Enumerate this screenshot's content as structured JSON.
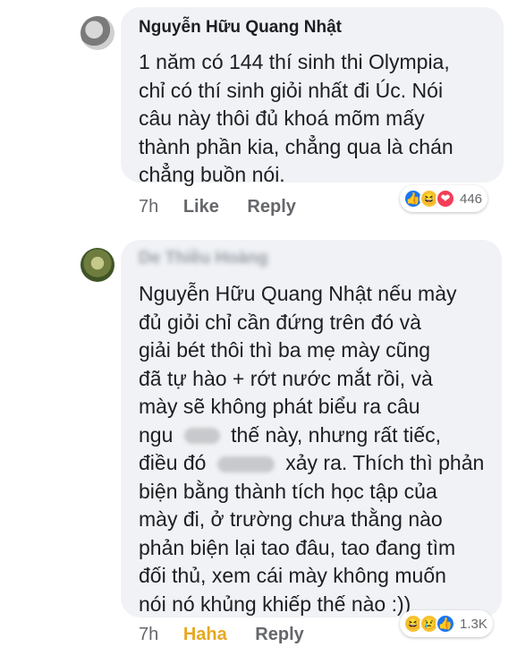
{
  "comments": [
    {
      "author": "Nguyễn Hữu Quang Nhật",
      "lines": [
        "1 năm có 144 thí sinh thi Olympia,",
        "chỉ có thí sinh giỏi nhất đi Úc. Nói",
        "câu này thôi đủ khoá mõm mấy",
        "thành phần kia, chẳng qua là chán",
        "chẳng buồn nói."
      ],
      "time": "7h",
      "action_react": "Like",
      "action_reply": "Reply",
      "reactions": [
        "like",
        "haha",
        "love"
      ],
      "reaction_count": "446"
    },
    {
      "author": "De Thiều Hoàng",
      "lines": [
        "Nguyễn Hữu Quang Nhật nếu mày",
        "đủ giỏi chỉ cần đứng trên đó và",
        "giải bét thôi thì ba mẹ mày cũng",
        "đã tự hào + rớt nước mắt rồi, và",
        "mày sẽ không phát biểu ra câu",
        "ngu",
        "thế này, nhưng rất tiếc,",
        "điều đó",
        "xảy ra. Thích thì phản",
        "biện bằng thành tích học tập của",
        "mày đi, ở trường chưa thằng nào",
        "phản biện lại tao đâu, tao đang tìm",
        "đối thủ, xem cái mày không muốn",
        "nói nó khủng khiếp thế nào  :))"
      ],
      "time": "7h",
      "action_react": "Haha",
      "action_reply": "Reply",
      "reactions": [
        "haha",
        "sad",
        "like"
      ],
      "reaction_count": "1.3K"
    }
  ],
  "colors": {
    "bubble": "#f0f2f5",
    "meta": "#65676b",
    "haha_active": "#e7a820",
    "like": "#1877f2",
    "love": "#f33e58"
  }
}
